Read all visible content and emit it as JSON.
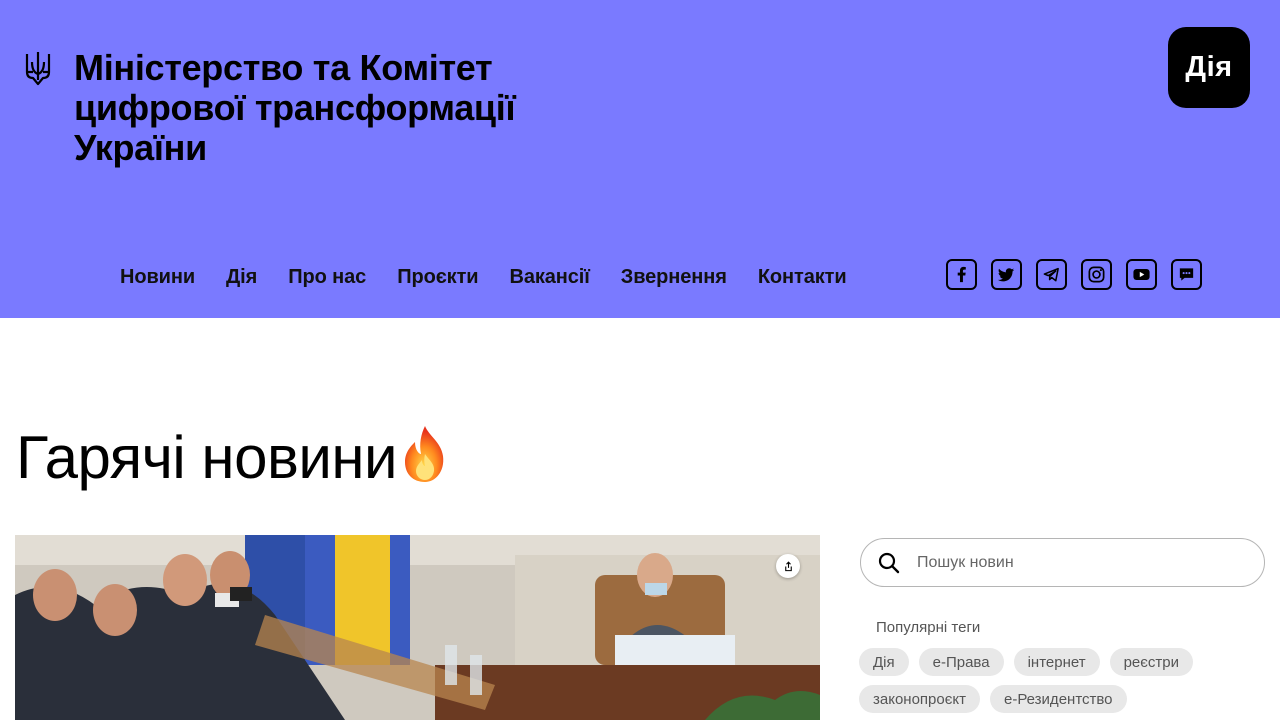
{
  "header": {
    "title_lines": [
      "Міністерство та Комітет",
      "цифрової трансформації",
      "України"
    ],
    "emblem_icon": "trident-icon",
    "diia_logo": "Дія",
    "background_color": "#7a7aff"
  },
  "nav": {
    "items": [
      {
        "label": "Новини"
      },
      {
        "label": "Дія"
      },
      {
        "label": "Про нас"
      },
      {
        "label": "Проєкти"
      },
      {
        "label": "Вакансії"
      },
      {
        "label": "Звернення"
      },
      {
        "label": "Контакти"
      }
    ]
  },
  "socials": [
    {
      "icon": "facebook-icon"
    },
    {
      "icon": "twitter-icon"
    },
    {
      "icon": "telegram-icon"
    },
    {
      "icon": "instagram-icon"
    },
    {
      "icon": "youtube-icon"
    },
    {
      "icon": "chat-icon"
    }
  ],
  "main": {
    "heading": "Гарячі новини",
    "heading_emoji": "fire-icon"
  },
  "sidebar": {
    "search": {
      "placeholder": "Пошук новин",
      "value": ""
    },
    "tags_heading": "Популярні теги",
    "tags": [
      "Дія",
      "е-Права",
      "інтернет",
      "реєстри",
      "законопроєкт",
      "е-Резидентство"
    ]
  }
}
